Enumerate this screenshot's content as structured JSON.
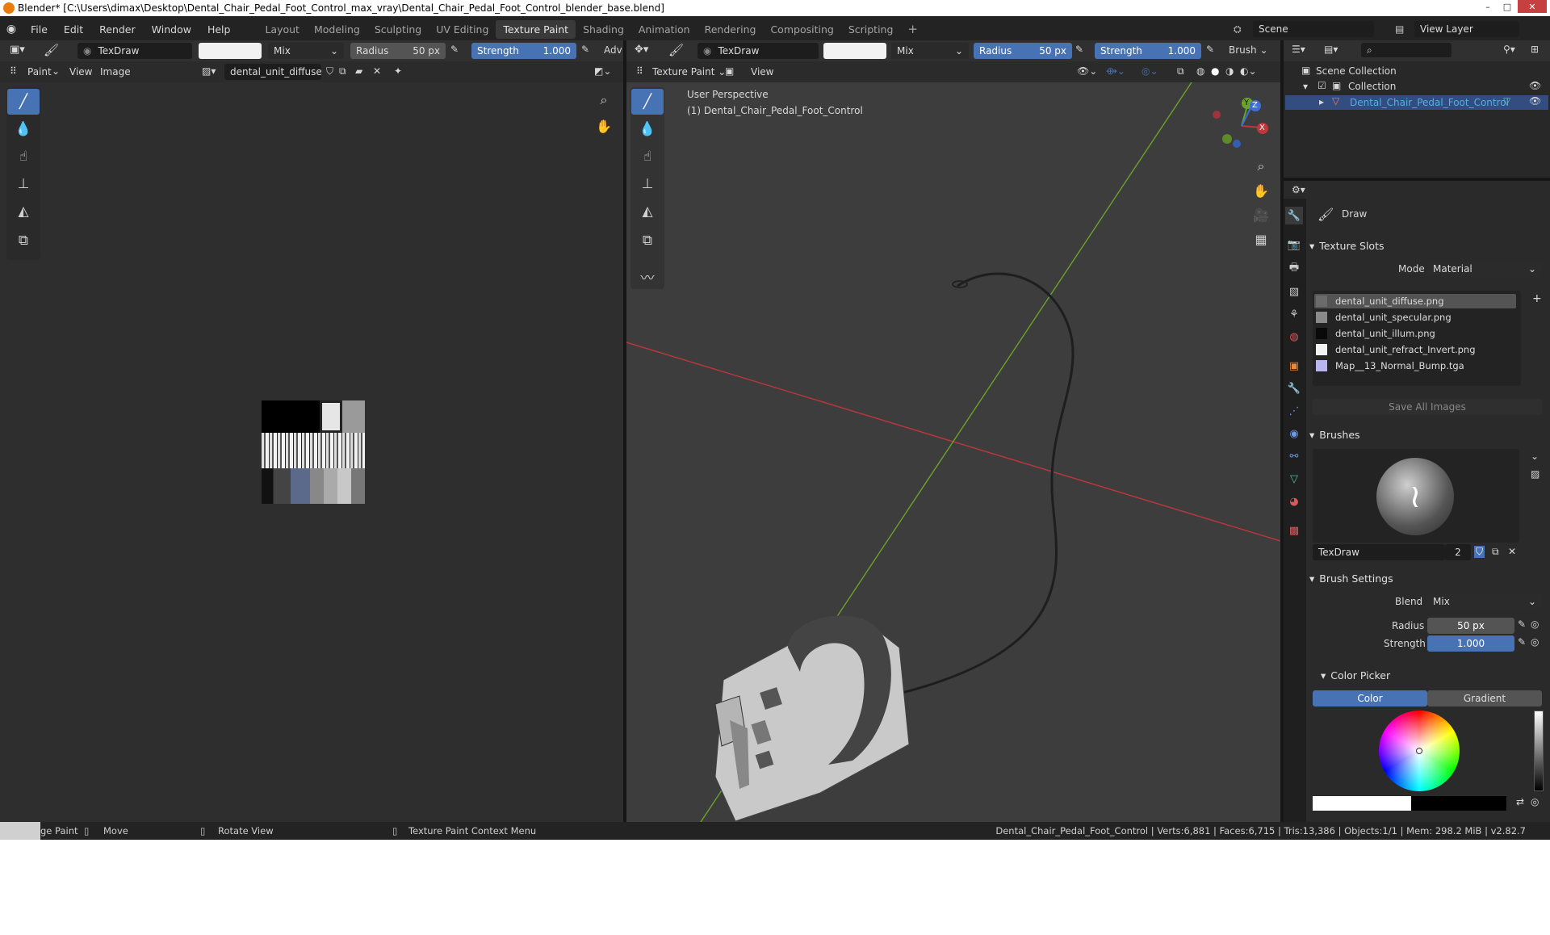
{
  "window": {
    "title": "Blender* [C:\\Users\\dimax\\Desktop\\Dental_Chair_Pedal_Foot_Control_max_vray\\Dental_Chair_Pedal_Foot_Control_blender_base.blend]",
    "minimize": "–",
    "maximize": "□",
    "close": "✕"
  },
  "menus": [
    "File",
    "Edit",
    "Render",
    "Window",
    "Help"
  ],
  "workspaces": [
    "Layout",
    "Modeling",
    "Sculpting",
    "UV Editing",
    "Texture Paint",
    "Shading",
    "Animation",
    "Rendering",
    "Compositing",
    "Scripting"
  ],
  "active_workspace": "Texture Paint",
  "add_workspace": "+",
  "scene": {
    "label": "Scene",
    "view_layer": "View Layer"
  },
  "image_editor": {
    "brush_name": "TexDraw",
    "blend": "Mix",
    "radius_label": "Radius",
    "radius_value": "50 px",
    "strength_label": "Strength",
    "strength_value": "1.000",
    "adv": "Adv",
    "mode": "Paint",
    "view": "View",
    "image_menu": "Image",
    "image_name": "dental_unit_diffuse.p.."
  },
  "viewport": {
    "brush_name": "TexDraw",
    "blend": "Mix",
    "radius_label": "Radius",
    "radius_value": "50 px",
    "strength_label": "Strength",
    "strength_value": "1.000",
    "brush_menu": "Brush",
    "mode": "Texture Paint",
    "view": "View",
    "perspective": "User Perspective",
    "object": "(1) Dental_Chair_Pedal_Foot_Control",
    "gizmo": {
      "x": "X",
      "y": "Y",
      "z": "Z"
    }
  },
  "outliner": {
    "scene_collection": "Scene Collection",
    "collection": "Collection",
    "object": "Dental_Chair_Pedal_Foot_Control"
  },
  "properties": {
    "tool_name": "Draw",
    "texture_slots_header": "Texture Slots",
    "mode_label": "Mode",
    "mode_value": "Material",
    "slots": [
      {
        "name": "dental_unit_diffuse.png",
        "color": "#6b6b6b"
      },
      {
        "name": "dental_unit_specular.png",
        "color": "#8a8a8a"
      },
      {
        "name": "dental_unit_illum.png",
        "color": "#0a0a0a"
      },
      {
        "name": "dental_unit_refract_Invert.png",
        "color": "#f2f2f2"
      },
      {
        "name": "Map__13_Normal_Bump.tga",
        "color": "#b8b5f0"
      }
    ],
    "save_all": "Save All Images",
    "brushes_header": "Brushes",
    "brush_name": "TexDraw",
    "brush_users": "2",
    "brush_settings_header": "Brush Settings",
    "blend_label": "Blend",
    "blend_value": "Mix",
    "radius_label": "Radius",
    "radius_value": "50 px",
    "strength_label": "Strength",
    "strength_value": "1.000",
    "color_picker_header": "Color Picker",
    "color_tab": "Color",
    "gradient_tab": "Gradient"
  },
  "status": {
    "left_mode": "ge Paint",
    "move": "Move",
    "rotate": "Rotate View",
    "context": "Texture Paint Context Menu",
    "stats": "Dental_Chair_Pedal_Foot_Control | Verts:6,881 | Faces:6,715 | Tris:13,386 | Objects:1/1 | Mem: 298.2 MiB | v2.82.7"
  },
  "colors": {
    "accent": "#4772b3",
    "x_axis": "#c0363d",
    "y_axis": "#6aa22a",
    "object_active": "#4eb0e8"
  }
}
